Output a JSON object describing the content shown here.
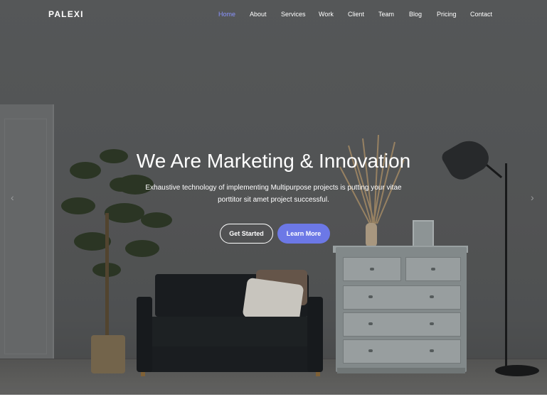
{
  "header": {
    "brand": "PALEXI",
    "menu": [
      {
        "label": "Home",
        "active": true
      },
      {
        "label": "About"
      },
      {
        "label": "Services"
      },
      {
        "label": "Work"
      },
      {
        "label": "Client"
      },
      {
        "label": "Team"
      },
      {
        "label": "Blog"
      },
      {
        "label": "Pricing"
      },
      {
        "label": "Contact"
      }
    ]
  },
  "hero": {
    "title": "We Are Marketing & Innovation",
    "subtitle_line1": "Exhaustive technology of implementing Multipurpose projects is putting your vitae",
    "subtitle_line2": "porttitor sit amet project successful.",
    "primary_button": "Get Started",
    "secondary_button": "Learn More",
    "prev_arrow": "‹",
    "next_arrow": "›"
  },
  "colors": {
    "accent": "#6c78e6",
    "active_nav": "#8a94ff",
    "text": "#ffffff"
  },
  "icons": {
    "prev": "chevron-left-icon",
    "next": "chevron-right-icon"
  }
}
